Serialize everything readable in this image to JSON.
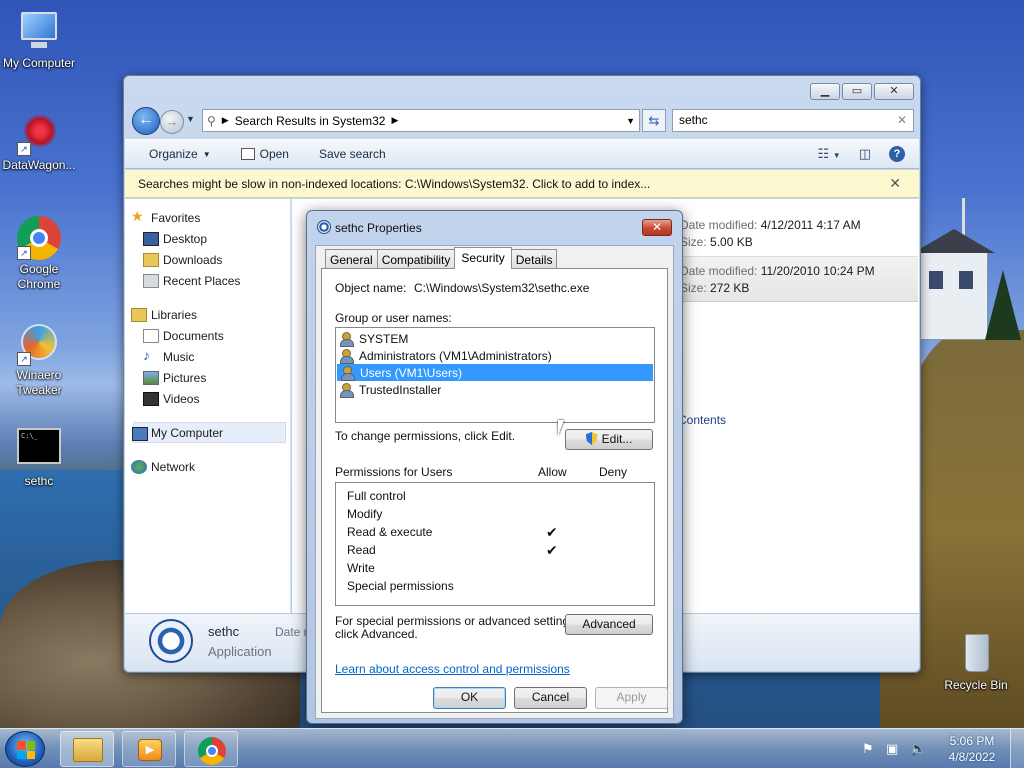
{
  "desktop": {
    "icons": [
      {
        "label": "My Computer"
      },
      {
        "label": "DataWagon..."
      },
      {
        "label": "Google Chrome"
      },
      {
        "label": "Winaero Tweaker"
      },
      {
        "label": "sethc"
      },
      {
        "label": "Recycle Bin"
      }
    ]
  },
  "explorer": {
    "address": {
      "crumb": "Search Results in System32"
    },
    "search": {
      "value": "sethc"
    },
    "toolbar": {
      "organize": "Organize",
      "open": "Open",
      "save_search": "Save search"
    },
    "infobar": "Searches might be slow in non-indexed locations: C:\\Windows\\System32. Click to add to index...",
    "nav": {
      "favorites": "Favorites",
      "desktop": "Desktop",
      "downloads": "Downloads",
      "recent": "Recent Places",
      "libraries": "Libraries",
      "documents": "Documents",
      "music": "Music",
      "pictures": "Pictures",
      "videos": "Videos",
      "computer": "My Computer",
      "network": "Network"
    },
    "results": [
      {
        "date_label": "Date modified:",
        "date": "4/12/2011 4:17 AM",
        "size_label": "Size:",
        "size": "5.00 KB"
      },
      {
        "date_label": "Date modified:",
        "date": "11/20/2010 10:24 PM",
        "size_label": "Size:",
        "size": "272 KB"
      }
    ],
    "contents_link": "Contents",
    "details": {
      "name": "sethc",
      "type": "Application",
      "date_label": "Date m"
    }
  },
  "dialog": {
    "title": "sethc Properties",
    "tabs": [
      "General",
      "Compatibility",
      "Security",
      "Details"
    ],
    "object_label": "Object name:",
    "object_value": "C:\\Windows\\System32\\sethc.exe",
    "group_label": "Group or user names:",
    "groups": [
      "SYSTEM",
      "Administrators (VM1\\Administrators)",
      "Users (VM1\\Users)",
      "TrustedInstaller"
    ],
    "change_text": "To change permissions, click Edit.",
    "edit_btn": "Edit...",
    "perm_label": "Permissions for Users",
    "allow": "Allow",
    "deny": "Deny",
    "permissions": [
      {
        "name": "Full control",
        "allow": ""
      },
      {
        "name": "Modify",
        "allow": ""
      },
      {
        "name": "Read & execute",
        "allow": "✔"
      },
      {
        "name": "Read",
        "allow": "✔"
      },
      {
        "name": "Write",
        "allow": ""
      },
      {
        "name": "Special permissions",
        "allow": ""
      }
    ],
    "special_text_1": "For special permissions or advanced settings,",
    "special_text_2": "click Advanced.",
    "advanced_btn": "Advanced",
    "learn_link": "Learn about access control and permissions",
    "ok": "OK",
    "cancel": "Cancel",
    "apply": "Apply"
  },
  "taskbar": {
    "time": "5:06 PM",
    "date": "4/8/2022"
  }
}
